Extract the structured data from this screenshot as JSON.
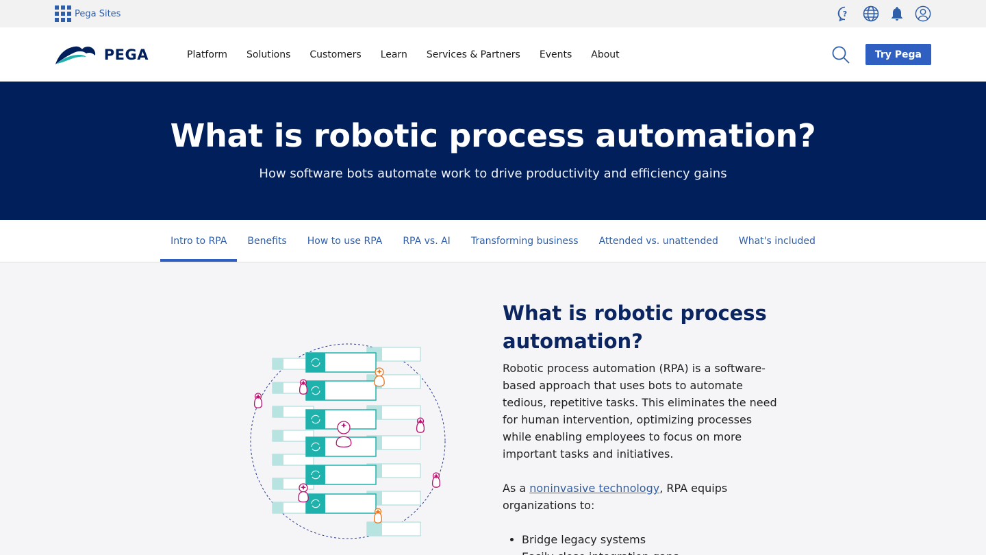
{
  "utility": {
    "sites_label": "Pega Sites",
    "icons": [
      "help-icon",
      "globe-icon",
      "bell-icon",
      "user-icon"
    ]
  },
  "nav": {
    "logo_text": "PEGA",
    "items": [
      "Platform",
      "Solutions",
      "Customers",
      "Learn",
      "Services & Partners",
      "Events",
      "About"
    ],
    "cta_label": "Try Pega"
  },
  "hero": {
    "title": "What is robotic process automation?",
    "subtitle": "How software bots automate work to drive productivity and efficiency gains"
  },
  "tabs": {
    "items": [
      "Intro to RPA",
      "Benefits",
      "How to use RPA",
      "RPA vs. AI",
      "Transforming business",
      "Attended vs. unattended",
      "What's included"
    ],
    "active": "Intro to RPA"
  },
  "article": {
    "heading": "What is robotic process automation?",
    "para1": "Robotic process automation (RPA) is a software-based approach that uses bots to automate tedious, repetitive tasks. This eliminates the need for human intervention, optimizing processes while enabling employees to focus on more important tasks and initiatives.",
    "para2_before": "As a ",
    "para2_link": "noninvasive technology",
    "para2_after": ", RPA equips organizations to:",
    "bullets": [
      "Bridge legacy systems",
      "Easily close integration gaps"
    ]
  },
  "colors": {
    "navy": "#001f5b",
    "accent_blue": "#2f5fc0",
    "teal": "#1fb1ab",
    "magenta": "#b5166f",
    "orange": "#e87722"
  }
}
